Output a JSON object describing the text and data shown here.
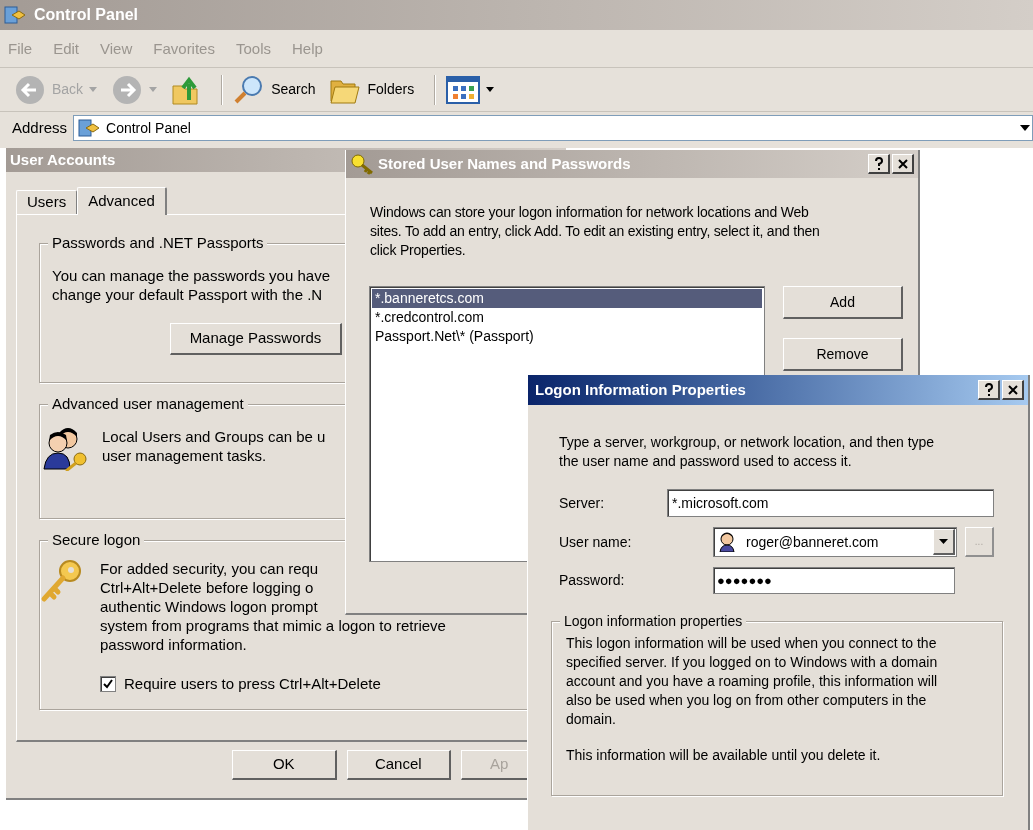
{
  "explorer": {
    "title": "Control Panel",
    "active": false,
    "menu": [
      "File",
      "Edit",
      "View",
      "Favorites",
      "Tools",
      "Help"
    ],
    "toolbar": [
      {
        "kind": "back",
        "label": "Back",
        "disabled": true
      },
      {
        "kind": "forward",
        "disabled": true
      },
      {
        "kind": "up",
        "disabled": false
      },
      {
        "kind": "search",
        "label": "Search",
        "disabled": false
      },
      {
        "kind": "folders",
        "label": "Folders",
        "disabled": false
      },
      {
        "kind": "views",
        "disabled": false
      }
    ],
    "address": {
      "label": "Address",
      "value": "Control Panel"
    }
  },
  "user_accounts": {
    "title": "User Accounts",
    "active": false,
    "tabs": [
      {
        "label": "Users",
        "selected": false
      },
      {
        "label": "Advanced",
        "selected": true
      }
    ],
    "groups": [
      {
        "kind": "passwords",
        "title": "Passwords and .NET Passports",
        "lines": [
          "You can manage the passwords you have",
          "change your default Passport with the .N"
        ],
        "button": "Manage Passwords"
      },
      {
        "kind": "management",
        "title": "Advanced user management",
        "lines": [
          "Local Users and Groups can be u",
          "user management tasks."
        ]
      },
      {
        "kind": "secure",
        "title": "Secure logon",
        "lines": [
          "For added security, you can requ",
          "Ctrl+Alt+Delete before logging o",
          "authentic Windows logon prompt",
          "system from programs that mimic a logon to retrieve",
          "password information."
        ],
        "checkbox": {
          "label": "Require users to press Ctrl+Alt+Delete",
          "checked": true
        }
      }
    ],
    "buttons": [
      {
        "label": "OK",
        "disabled": false
      },
      {
        "label": "Cancel",
        "disabled": false
      },
      {
        "label": "Ap",
        "disabled": true
      }
    ]
  },
  "stored_dialog": {
    "title": "Stored User Names and Passwords",
    "active": false,
    "description_lines": [
      "Windows can store your logon information for network locations and Web",
      "sites. To add an entry, click Add. To edit an existing entry, select it, and then",
      "click Properties."
    ],
    "entries": [
      {
        "label": "*.banneretcs.com",
        "selected": true
      },
      {
        "label": "*.credcontrol.com",
        "selected": false
      },
      {
        "label": "Passport.Net\\* (Passport)",
        "selected": false
      }
    ],
    "buttons": [
      "Add",
      "Remove"
    ]
  },
  "logon_dialog": {
    "title": "Logon Information Properties",
    "active": true,
    "description_lines": [
      "Type a server, workgroup, or network location, and then type",
      "the user name and password used to access it."
    ],
    "server": {
      "label": "Server:",
      "value": "*.microsoft.com"
    },
    "user_name": {
      "label": "User name:",
      "value": "roger@banneret.com"
    },
    "browse_button": {
      "label": "...",
      "disabled": true
    },
    "password": {
      "label": "Password:",
      "value": "●●●●●●●"
    },
    "group": {
      "title": "Logon information properties",
      "lines": [
        "This logon information will be used when you connect to the",
        "specified server. If you logged on to Windows with a domain",
        "account and you have a roaming profile, this information will",
        "also be used when you log on from other computers in the",
        "domain."
      ],
      "note": "This information will be available until you delete it."
    }
  }
}
